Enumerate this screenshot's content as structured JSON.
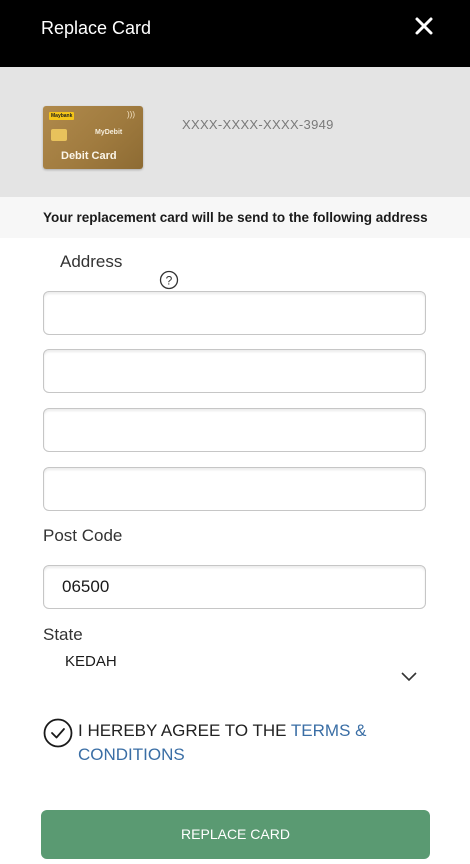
{
  "header": {
    "title": "Replace Card",
    "close_icon": "close-icon"
  },
  "card": {
    "brand": "Maybank",
    "network": "MyDebit",
    "label": "Debit Card",
    "number": "XXXX-XXXX-XXXX-3949"
  },
  "notice": "Your replacement card will be send to the following address",
  "address": {
    "label": "Address",
    "help_icon": "question-circle-icon",
    "lines": [
      "",
      "",
      "",
      ""
    ]
  },
  "postcode": {
    "label": "Post Code",
    "value": "06500"
  },
  "state": {
    "label": "State",
    "value": "KEDAH",
    "icon": "chevron-down-icon"
  },
  "agreement": {
    "text": "I HEREBY AGREE TO THE ",
    "link": "TERMS & CONDITIONS",
    "checked": true
  },
  "submit": {
    "label": "REPLACE CARD",
    "color": "#5a9a72"
  }
}
